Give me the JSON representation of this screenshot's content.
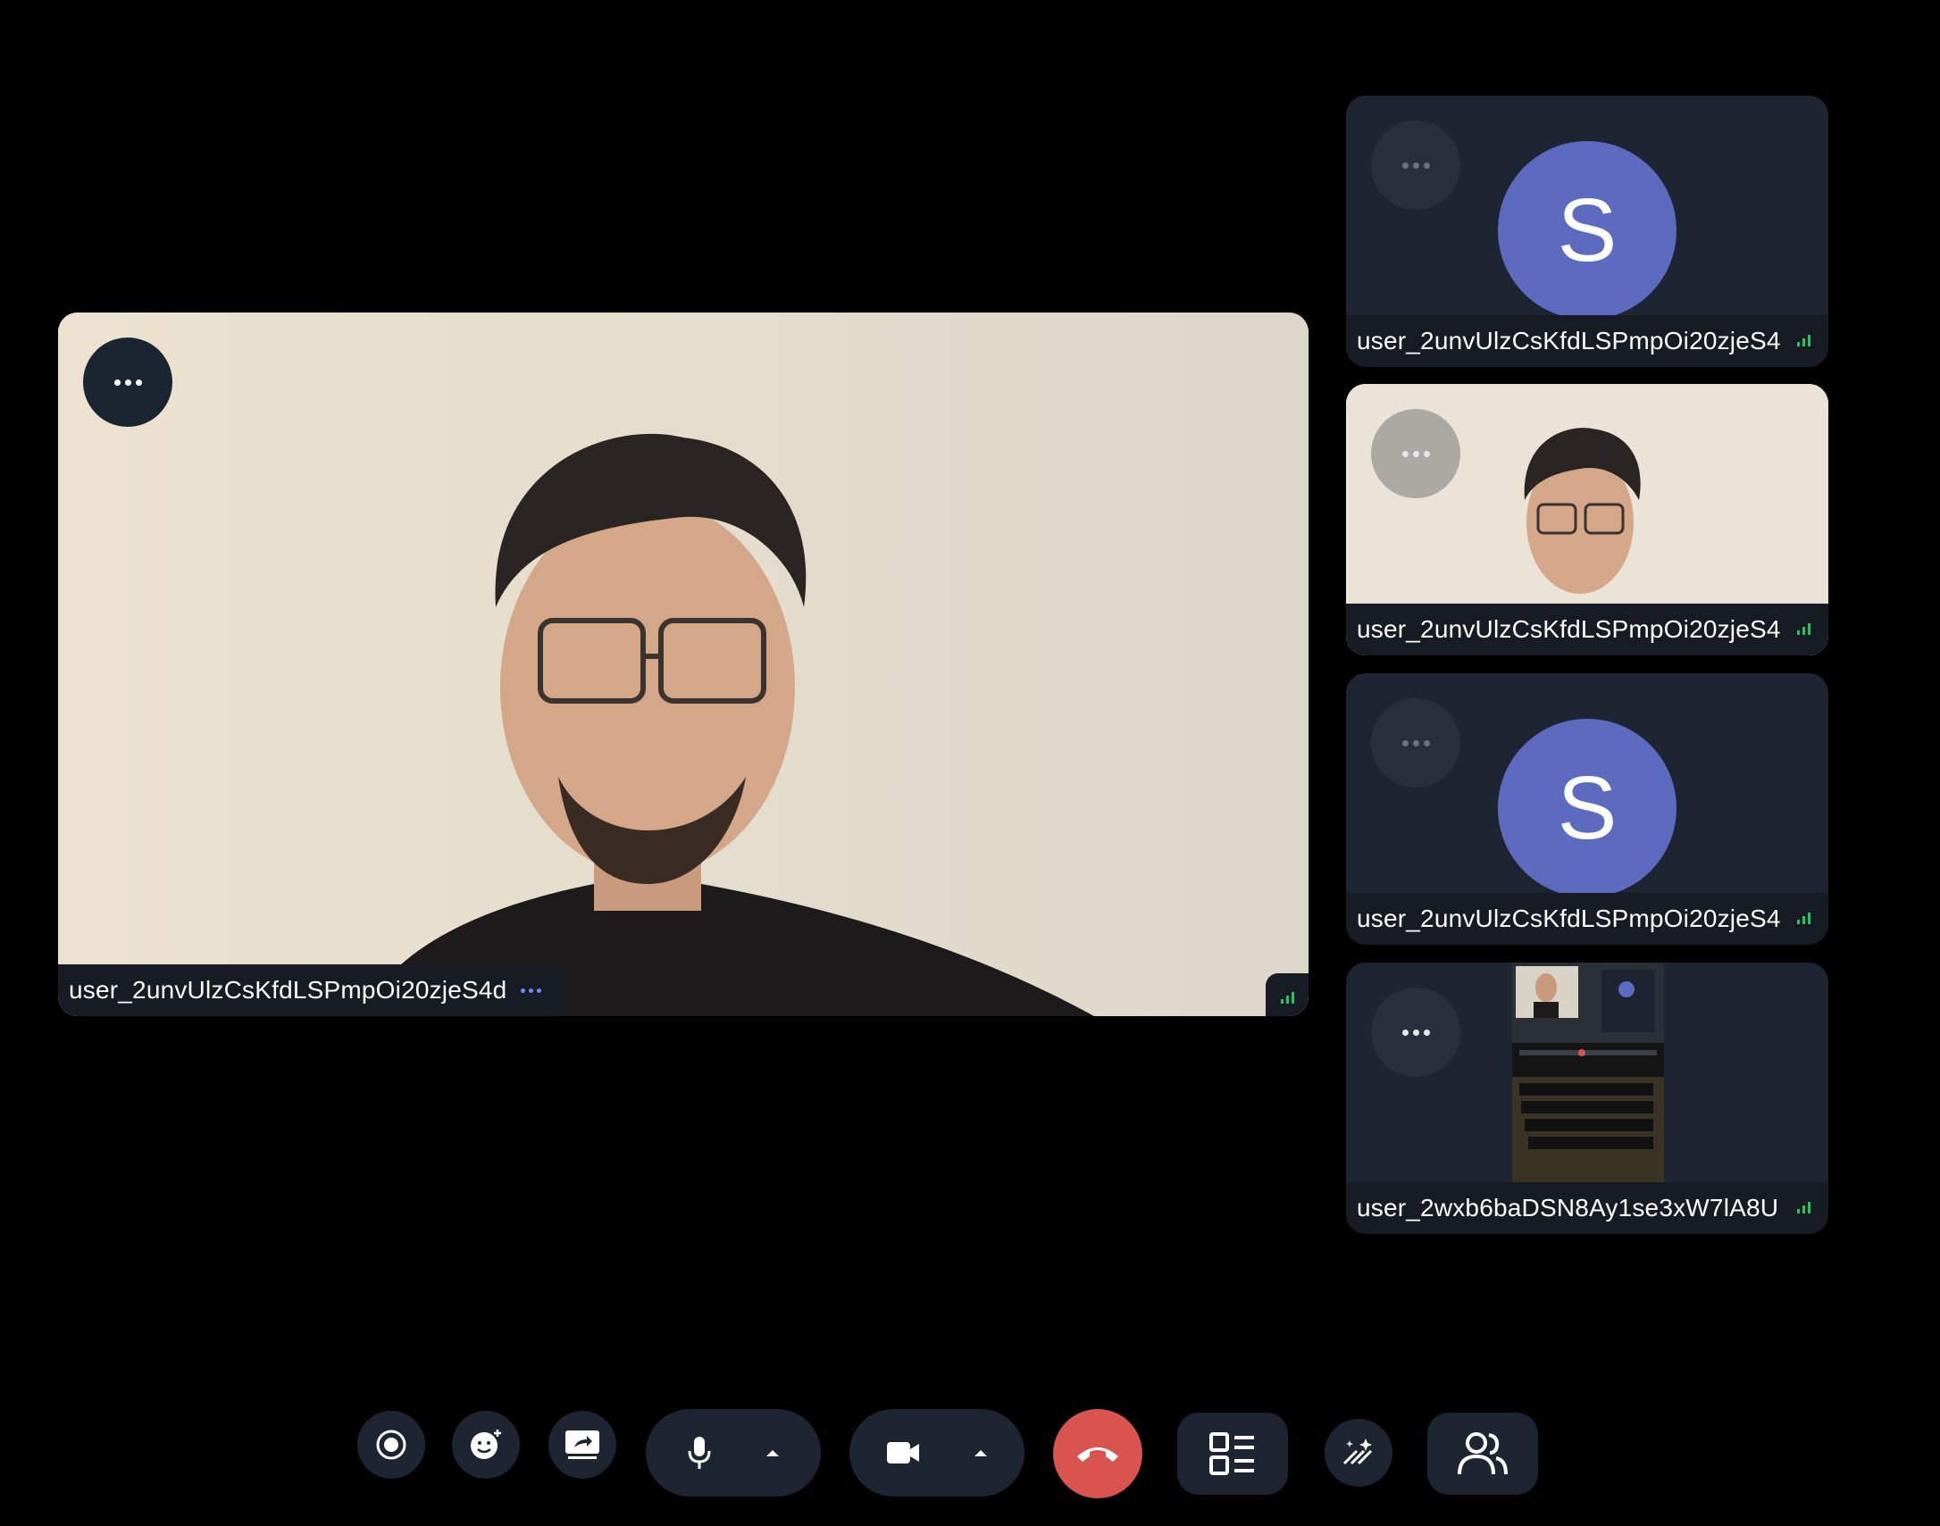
{
  "main_tile": {
    "participant_name": "user_2unvUlzCsKfdLSPmpOi20zjeS4d"
  },
  "side_tiles": [
    {
      "participant_name": "user_2unvUlzCsKfdLSPmpOi20zjeS4",
      "avatar_letter": "S",
      "type": "avatar"
    },
    {
      "participant_name": "user_2unvUlzCsKfdLSPmpOi20zjeS4",
      "type": "video"
    },
    {
      "participant_name": "user_2unvUlzCsKfdLSPmpOi20zjeS4",
      "avatar_letter": "S",
      "type": "avatar"
    },
    {
      "participant_name": "user_2wxb6baDSN8Ay1se3xW7lA8U",
      "type": "screen-share"
    }
  ],
  "colors": {
    "background": "#000000",
    "tile": "#1e2532",
    "avatar": "#5c6bc0",
    "end_call": "#d9534f",
    "signal": "#22c55e",
    "menu_dots": "#6a8cff"
  },
  "toolbar": {
    "icons": [
      "record-icon",
      "emoji-icon",
      "screen-share-icon",
      "microphone-icon",
      "chevron-up-icon",
      "camera-icon",
      "chevron-up-icon",
      "end-call-icon",
      "layout-icon",
      "effects-icon",
      "participants-icon"
    ]
  }
}
